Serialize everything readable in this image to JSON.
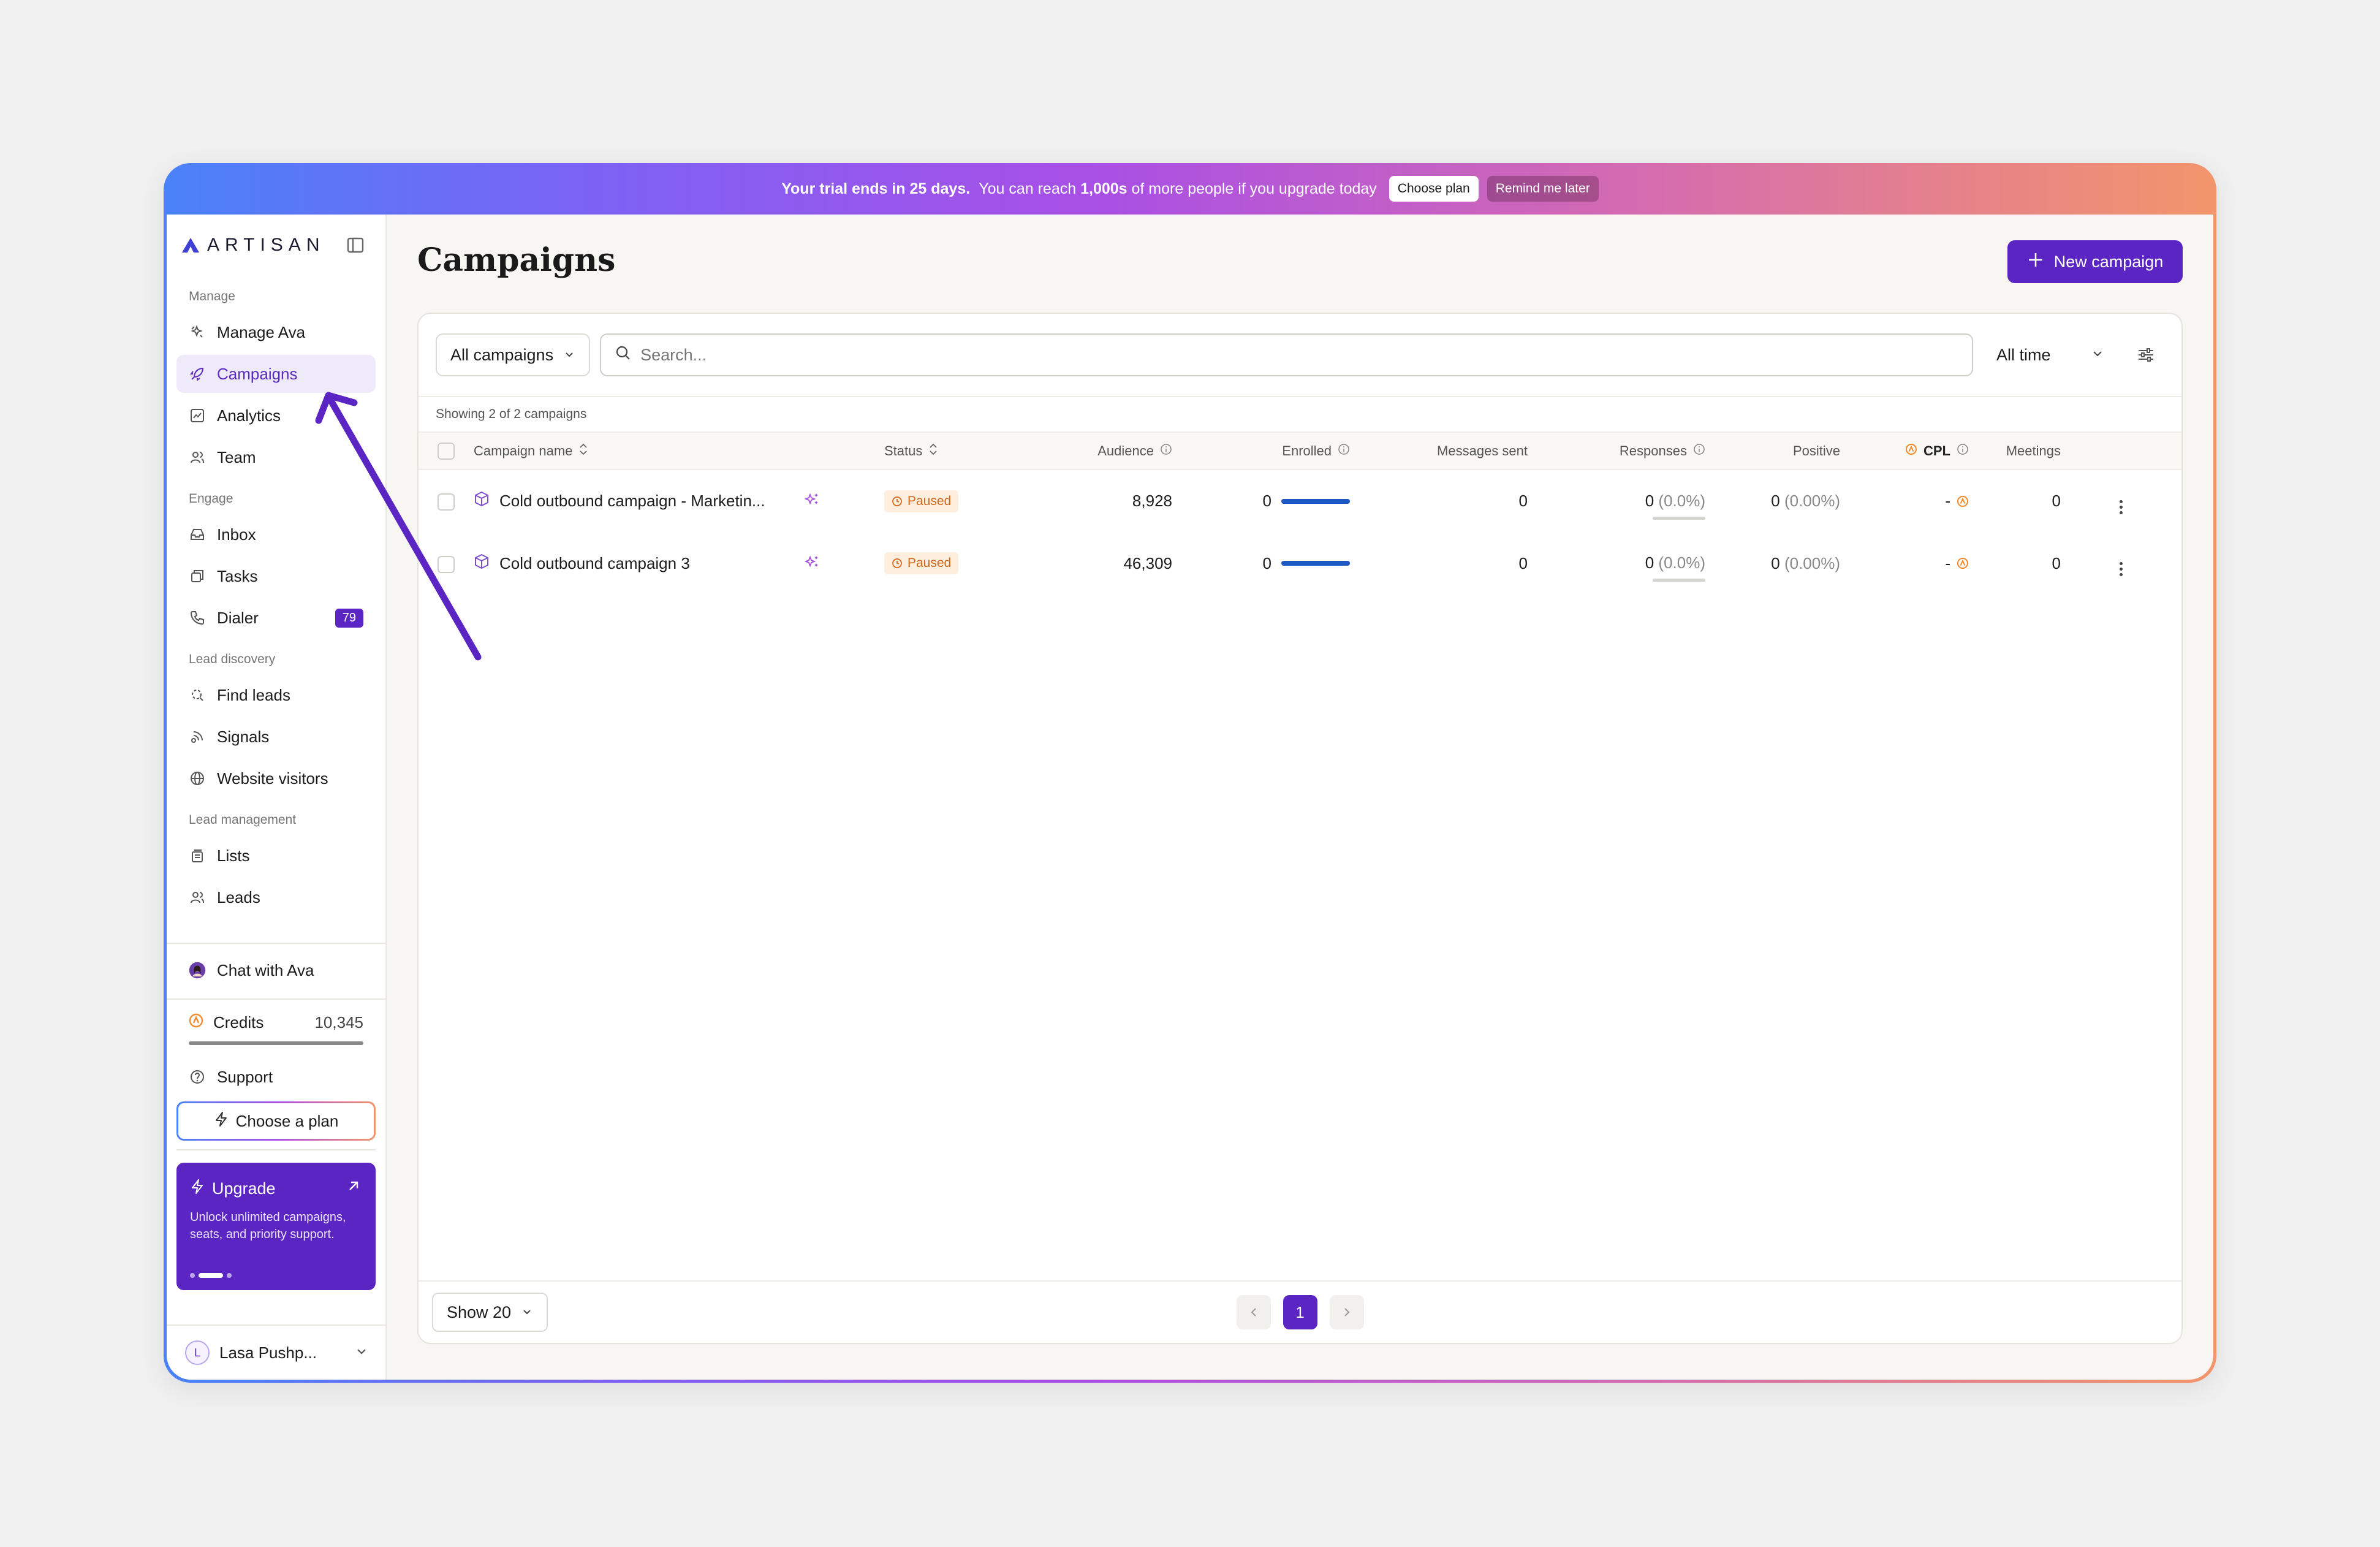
{
  "banner": {
    "trial_text": "Your trial ends in 25 days.",
    "reach_prefix": "You can reach",
    "reach_bold": "1,000s",
    "reach_suffix": "of more people if you upgrade today",
    "choose_plan": "Choose plan",
    "remind_later": "Remind me later"
  },
  "brand": {
    "name": "ARTISAN"
  },
  "sidebar": {
    "sections": [
      {
        "label": "Manage"
      },
      {
        "label": "Engage"
      },
      {
        "label": "Lead discovery"
      },
      {
        "label": "Lead management"
      }
    ],
    "items": [
      {
        "label": "Manage Ava",
        "icon": "sparkle-icon"
      },
      {
        "label": "Campaigns",
        "icon": "rocket-icon"
      },
      {
        "label": "Analytics",
        "icon": "chart-icon"
      },
      {
        "label": "Team",
        "icon": "users-icon"
      },
      {
        "label": "Inbox",
        "icon": "inbox-icon"
      },
      {
        "label": "Tasks",
        "icon": "tasks-icon"
      },
      {
        "label": "Dialer",
        "icon": "phone-icon",
        "badge": "79"
      },
      {
        "label": "Find leads",
        "icon": "search-lead-icon"
      },
      {
        "label": "Signals",
        "icon": "signal-icon"
      },
      {
        "label": "Website visitors",
        "icon": "globe-icon"
      },
      {
        "label": "Lists",
        "icon": "list-icon"
      },
      {
        "label": "Leads",
        "icon": "users-icon"
      }
    ],
    "chat": "Chat with Ava",
    "credits_label": "Credits",
    "credits_value": "10,345",
    "support": "Support",
    "choose_plan": "Choose a plan",
    "upgrade": {
      "title": "Upgrade",
      "desc": "Unlock unlimited campaigns, seats, and priority support."
    },
    "user": {
      "initial": "L",
      "name": "Lasa Pushp..."
    }
  },
  "main": {
    "title": "Campaigns",
    "new_campaign": "New campaign",
    "filter": "All campaigns",
    "search_placeholder": "Search...",
    "time_range": "All time",
    "showing": "Showing 2 of 2 campaigns",
    "columns": [
      "Campaign name",
      "Status",
      "Audience",
      "Enrolled",
      "Messages sent",
      "Responses",
      "Positive",
      "CPL",
      "Meetings"
    ],
    "rows": [
      {
        "name": "Cold outbound campaign - Marketin...",
        "status": "Paused",
        "audience": "8,928",
        "enrolled": "0",
        "messages": "0",
        "responses": "0",
        "responses_pct": "(0.0%)",
        "positive": "0",
        "positive_pct": "(0.00%)",
        "cpl": "-",
        "meetings": "0"
      },
      {
        "name": "Cold outbound campaign 3",
        "status": "Paused",
        "audience": "46,309",
        "enrolled": "0",
        "messages": "0",
        "responses": "0",
        "responses_pct": "(0.0%)",
        "positive": "0",
        "positive_pct": "(0.00%)",
        "cpl": "-",
        "meetings": "0"
      }
    ],
    "page_size": "Show 20",
    "current_page": "1"
  },
  "colors": {
    "accent": "#5a25c2",
    "status_paused": "#d2691e",
    "enroll_bar": "#1f57c4"
  }
}
